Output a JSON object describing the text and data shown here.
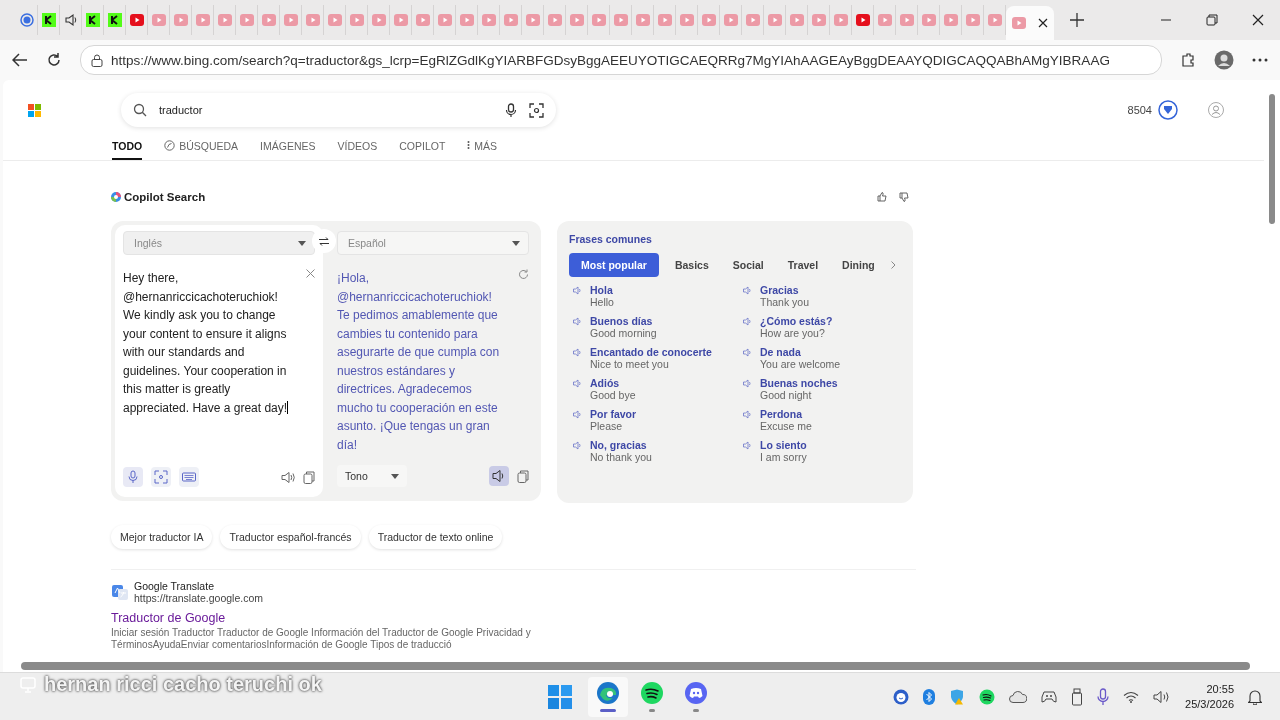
{
  "browser": {
    "tabs": [
      {
        "kind": "blue-circle",
        "selected": false
      },
      {
        "kind": "green-square",
        "selected": false
      },
      {
        "kind": "speaker",
        "selected": false
      },
      {
        "kind": "green-square",
        "selected": false
      },
      {
        "kind": "green-square",
        "selected": false
      },
      {
        "kind": "red-video",
        "selected": false
      },
      {
        "kind": "pink-video",
        "selected": false
      },
      {
        "kind": "pink-video",
        "selected": false
      },
      {
        "kind": "pink-video",
        "selected": false
      },
      {
        "kind": "pink-video",
        "selected": false
      },
      {
        "kind": "pink-video",
        "selected": false
      },
      {
        "kind": "pink-video",
        "selected": false
      },
      {
        "kind": "pink-video",
        "selected": false
      },
      {
        "kind": "pink-video",
        "selected": false
      },
      {
        "kind": "pink-video",
        "selected": false
      },
      {
        "kind": "pink-video",
        "selected": false
      },
      {
        "kind": "pink-video",
        "selected": false
      },
      {
        "kind": "pink-video",
        "selected": false
      },
      {
        "kind": "pink-video",
        "selected": false
      },
      {
        "kind": "pink-video",
        "selected": false
      },
      {
        "kind": "pink-video",
        "selected": false
      },
      {
        "kind": "pink-video",
        "selected": false
      },
      {
        "kind": "pink-video",
        "selected": false
      },
      {
        "kind": "pink-video",
        "selected": false
      },
      {
        "kind": "pink-video",
        "selected": false
      },
      {
        "kind": "pink-video",
        "selected": false
      },
      {
        "kind": "pink-video",
        "selected": false
      },
      {
        "kind": "pink-video",
        "selected": false
      },
      {
        "kind": "pink-video",
        "selected": false
      },
      {
        "kind": "pink-video",
        "selected": false
      },
      {
        "kind": "pink-video",
        "selected": false
      },
      {
        "kind": "pink-video",
        "selected": false
      },
      {
        "kind": "pink-video",
        "selected": false
      },
      {
        "kind": "pink-video",
        "selected": false
      },
      {
        "kind": "pink-video",
        "selected": false
      },
      {
        "kind": "pink-video",
        "selected": false
      },
      {
        "kind": "pink-video",
        "selected": false
      },
      {
        "kind": "pink-video",
        "selected": false
      },
      {
        "kind": "red-video",
        "selected": false
      },
      {
        "kind": "pink-video",
        "selected": false
      },
      {
        "kind": "pink-video",
        "selected": false
      },
      {
        "kind": "pink-video",
        "selected": false
      },
      {
        "kind": "pink-video",
        "selected": false
      },
      {
        "kind": "pink-video",
        "selected": false
      },
      {
        "kind": "pink-video",
        "selected": false
      },
      {
        "kind": "pink-video",
        "selected": true
      }
    ],
    "address": "https://www.bing.com/search?q=traductor&gs_lcrp=EgRlZGdlKgYIARBFGDsyBggAEEUYOTIGCAEQRRg7MgYIAhAAGEAyBggDEAAYQDIGCAQQABhAMgYIBRAAG"
  },
  "search": {
    "query": "traductor",
    "rewards_points": "8504"
  },
  "nav_tabs": [
    {
      "label": "TODO",
      "kind": "plain",
      "selected": true
    },
    {
      "label": "BÚSQUEDA",
      "kind": "copilot",
      "selected": false
    },
    {
      "label": "IMÁGENES",
      "kind": "plain",
      "selected": false
    },
    {
      "label": "VÍDEOS",
      "kind": "plain",
      "selected": false
    },
    {
      "label": "COPILOT",
      "kind": "plain",
      "selected": false
    },
    {
      "label": "MÁS",
      "kind": "more",
      "selected": false
    }
  ],
  "copilot_search": {
    "title": "Copilot Search"
  },
  "translator": {
    "source_language": "Inglés",
    "target_language": "Español",
    "source_text": "Hey there, @hernanriccicachoteruchiok! We kindly ask you to change your content to ensure it aligns with our standards and guidelines. Your cooperation in this matter is greatly appreciated. Have a great day!",
    "translated_text": "¡Hola, @hernanriccicachoteruchiok! Te pedimos amablemente que cambies tu contenido para asegurarte de que cumpla con nuestros estándares y directrices. Agradecemos mucho tu cooperación en este asunto. ¡Que tengas un gran día!",
    "tone": "Tono"
  },
  "common_phrases": {
    "title": "Frases comunes",
    "categories": [
      {
        "label": "Most popular",
        "selected": true
      },
      {
        "label": "Basics",
        "selected": false
      },
      {
        "label": "Social",
        "selected": false
      },
      {
        "label": "Travel",
        "selected": false
      },
      {
        "label": "Dining",
        "selected": false
      }
    ],
    "phrases": [
      {
        "phrase": "Hola",
        "meaning": "Hello"
      },
      {
        "phrase": "Gracias",
        "meaning": "Thank you"
      },
      {
        "phrase": "Buenos días",
        "meaning": "Good morning"
      },
      {
        "phrase": "¿Cómo estás?",
        "meaning": "How are you?"
      },
      {
        "phrase": "Encantado de conocerte",
        "meaning": "Nice to meet you"
      },
      {
        "phrase": "De nada",
        "meaning": "You are welcome"
      },
      {
        "phrase": "Adiós",
        "meaning": "Good bye"
      },
      {
        "phrase": "Buenas noches",
        "meaning": "Good night"
      },
      {
        "phrase": "Por favor",
        "meaning": "Please"
      },
      {
        "phrase": "Perdona",
        "meaning": "Excuse me"
      },
      {
        "phrase": "No, gracias",
        "meaning": "No thank you"
      },
      {
        "phrase": "Lo siento",
        "meaning": "I am sorry"
      }
    ]
  },
  "related_searches": [
    "Mejor traductor IA",
    "Traductor español-francés",
    "Traductor de texto online"
  ],
  "results": [
    {
      "site": "Google Translate",
      "url": "https://translate.google.com",
      "title": "Traductor de Google",
      "snippet": "Iniciar sesión Traductor Traductor de Google Información del Traductor de Google Privacidad y TérminosAyudaEnviar comentariosInformación de Google Tipos de traducció"
    }
  ],
  "stream_caption": "hernan ricci cacho teruchi ok",
  "taskbar": {
    "apps": [
      {
        "kind": "edge",
        "selected": true
      },
      {
        "kind": "spotify",
        "selected": false
      },
      {
        "kind": "discord",
        "selected": false
      }
    ],
    "time": "20:55",
    "date": "25/3/2026"
  }
}
